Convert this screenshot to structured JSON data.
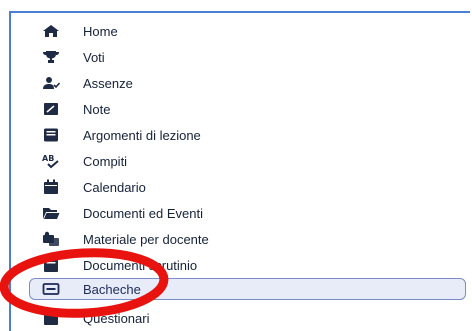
{
  "menu": {
    "items": [
      {
        "label": "Home",
        "icon": "home-icon"
      },
      {
        "label": "Voti",
        "icon": "trophy-icon"
      },
      {
        "label": "Assenze",
        "icon": "user-check-icon"
      },
      {
        "label": "Note",
        "icon": "note-icon"
      },
      {
        "label": "Argomenti di lezione",
        "icon": "lesson-topics-icon"
      },
      {
        "label": "Compiti",
        "icon": "spellcheck-icon"
      },
      {
        "label": "Calendario",
        "icon": "calendar-icon"
      },
      {
        "label": "Documenti ed Eventi",
        "icon": "folder-open-icon"
      },
      {
        "label": "Materiale per docente",
        "icon": "shared-material-icon"
      },
      {
        "label": "Documenti scrutinio",
        "icon": "scrutiny-document-icon"
      },
      {
        "label": "Bacheche",
        "icon": "board-icon",
        "selected": true
      },
      {
        "label": "Questionari",
        "icon": "survey-icon"
      }
    ]
  },
  "colors": {
    "frame_border": "#4a7fd4",
    "selected_bg": "#e8ebf8",
    "selected_border": "#7b8cc8",
    "annotation": "#e8130f"
  }
}
